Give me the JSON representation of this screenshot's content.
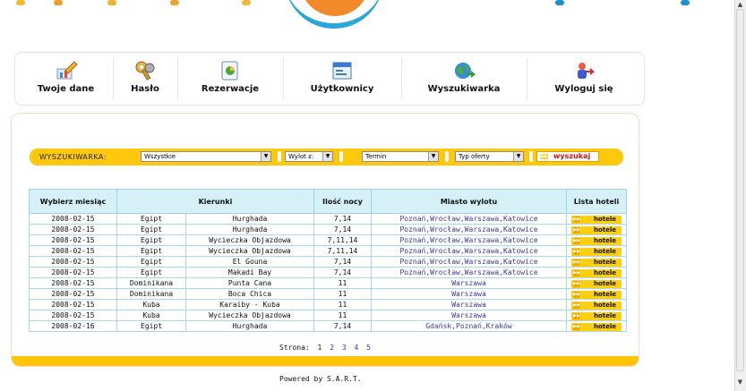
{
  "toolbar": {
    "items": [
      {
        "label": "Twoje dane",
        "icon": "pencil-chart-icon"
      },
      {
        "label": "Hasło",
        "icon": "key-icon"
      },
      {
        "label": "Rezerwacje",
        "icon": "document-icon"
      },
      {
        "label": "Użytkownicy",
        "icon": "window-icon"
      },
      {
        "label": "Wyszukiwarka",
        "icon": "globe-icon"
      },
      {
        "label": "Wyloguj się",
        "icon": "logout-icon"
      }
    ]
  },
  "search": {
    "label": "WYSZUKIWARKA:",
    "country": "Wszystkie",
    "departure": "Wylot z:",
    "term": "Termin",
    "offer_type": "Typ oferty",
    "button": "wyszukaj"
  },
  "table": {
    "headers": [
      "Wybierz miesiąc",
      "Kierunki",
      "Ilość nocy",
      "Miasto wylotu",
      "Lista hoteli"
    ],
    "rows": [
      {
        "date": "2008-02-15",
        "country": "Egipt",
        "place": "Hurghada",
        "nights": "7,14",
        "cities": "Poznań,Wrocław,Warszawa,Katowice"
      },
      {
        "date": "2008-02-15",
        "country": "Egipt",
        "place": "Hurghada",
        "nights": "7,14",
        "cities": "Poznań,Wrocław,Warszawa,Katowice"
      },
      {
        "date": "2008-02-15",
        "country": "Egipt",
        "place": "Wycieczka Objazdowa",
        "nights": "7,11,14",
        "cities": "Poznań,Wrocław,Warszawa,Katowice"
      },
      {
        "date": "2008-02-15",
        "country": "Egipt",
        "place": "Wycieczka Objazdowa",
        "nights": "7,11,14",
        "cities": "Poznań,Wrocław,Warszawa,Katowice"
      },
      {
        "date": "2008-02-15",
        "country": "Egipt",
        "place": "El Gouna",
        "nights": "7,14",
        "cities": "Poznań,Wrocław,Warszawa,Katowice"
      },
      {
        "date": "2008-02-15",
        "country": "Egipt",
        "place": "Makadi Bay",
        "nights": "7,14",
        "cities": "Poznań,Wrocław,Warszawa,Katowice"
      },
      {
        "date": "2008-02-15",
        "country": "Dominikana",
        "place": "Punta Cana",
        "nights": "11",
        "cities": "Warszawa"
      },
      {
        "date": "2008-02-15",
        "country": "Dominikana",
        "place": "Boca Chica",
        "nights": "11",
        "cities": "Warszawa"
      },
      {
        "date": "2008-02-15",
        "country": "Kuba",
        "place": "Karaiby - Kuba",
        "nights": "11",
        "cities": "Warszawa"
      },
      {
        "date": "2008-02-15",
        "country": "Kuba",
        "place": "Wycieczka Objazdowa",
        "nights": "11",
        "cities": "Warszawa"
      },
      {
        "date": "2008-02-16",
        "country": "Egipt",
        "place": "Hurghada",
        "nights": "7,14",
        "cities": "Gdańsk,Poznań,Kraków"
      }
    ],
    "hotel_button": "hotele"
  },
  "pager": {
    "label": "Strona:",
    "pages": [
      "1",
      "2",
      "3",
      "4",
      "5"
    ]
  },
  "footer": "Powered by S.A.R.T.",
  "colors": {
    "accent": "#fdc80e",
    "header_bg": "#d6f0f8",
    "link": "#3a3a9c",
    "search_button_text": "#d81010"
  }
}
